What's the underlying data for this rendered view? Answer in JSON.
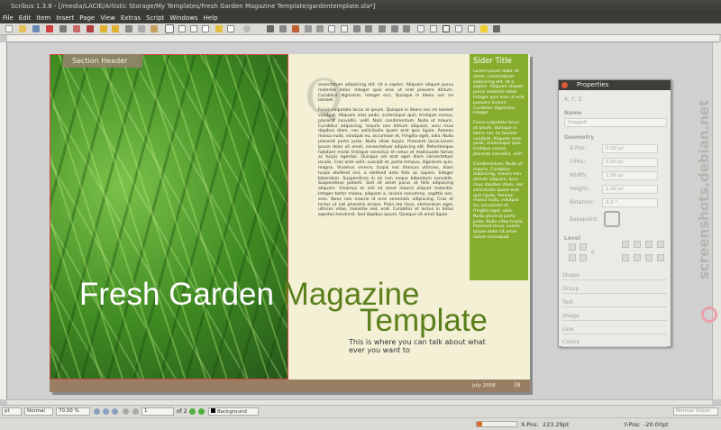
{
  "window": {
    "title": "Scribus 1.3.8 - [/media/LACIE/Artistic Storage/My Templates/Fresh Garden Magazine Template/gardentemplate.sla*]"
  },
  "menu": [
    "File",
    "Edit",
    "Item",
    "Insert",
    "Page",
    "View",
    "Extras",
    "Script",
    "Windows",
    "Help"
  ],
  "page": {
    "section_header": "Section Header",
    "q_letter": "Q",
    "body_paragraphs": [
      "onsectetuer adipiscing elit. Ut a sapien. Aliquam aliquet purus molestie dolor. Integer quis eros ut erat posuere dictum. Curabitur dignissim. Integer orci. Quisque in libero nec mi laoreet.",
      "Fusce vulputate lacus at ipsum. Quisque in libero nec mi laoreet volutpat. Aliquam eros pede, scelerisque quis, tristique cursus, placerat convallis, velit. Nam condimentum. Nulla ut mauris. Curabitur adipiscing, mauris non dictum aliquam, arcu risus dapibus diam, nec sollicitudin quam erat quis ligula. Aenean massa nulla, volutpat eu, accumsan et, fringilla eget, odio. Nulla placerat porta justo. Nulla vitae turpis. Praesent lacus.Lorem ipsum dolor sit amet, consectetuer adipiscing elit. Pellentesque habitant morbi tristique senectus et netus et malesuada fames ac turpis egestas. Quisque vel erat eget diam consectetuer iaculis. Cras ante velit, suscipit et, porta tempus, dignissim quis, magna. Vivamus viverra, turpis nec rhoncus ultricies, diam turpis eleifend nisl, a eleifend ante felis ac sapien. Integer bibendum. Suspendisse in mi non neque bibendum convallis. Suspendisse potenti. Sed sit amet purus at felis adipiscing aliquam. Vivamus et nisl sit amet mauris aliquet molestie. Integer tortor massa, aliquam a, lacinia nonummy, sagittis nec, eros. Nunc non mauris id eros venenatis adipiscing. Cras et lectus ut nisl pharetra ornare. Proin leo risus, elementum eget, ultrices vitae, molestie sed, erat. Curabitur et lectus in tellus egestas hendrerit. Sed dapibus ipsum. Quisque sit amet ligula"
    ],
    "sidebar_title": "Sider Title",
    "sidebar_paragraphs": [
      "Lorem ipsum dolor sit amet, consectetuer adipiscing elit. Ut a sapien. Aliquam aliquet purus molestie dolor. Integer quis eros ut erat posuere dictum. Curabitur dignissim. Integer",
      "Fusce vulputate lacus at ipsum. Quisque in libero nec mi laoreet volutpat. Aliquam eros pede, scelerisque quis, tristique cursus, placerat convallis, velit.",
      "Condimentum. Nulla ut mauris. Curabitur adipiscing, mauris non dictum aliquam, arcu risus dapibus diam, nec sollicitudin quam erat quis ligula. Aenean massa nulla, volutpat eu, accumsan et, fringilla eget, odio. Nulla placerat porta justo. Nulla vitae turpis. Praesent lacus. Lorem ipsum dolor sit amet conse consequat"
    ],
    "title_word_1": "Fresh Garden",
    "title_word_2": "Magazine",
    "title_line_2": "Template",
    "tagline": "This is where you can talk about what ever you want to",
    "footer_date": "July 2008",
    "footer_page": "38"
  },
  "properties": {
    "title": "Properties",
    "xyz_label": "X, Y, Z",
    "name_label": "Name",
    "name_value": "Image4",
    "geometry_label": "Geometry",
    "xpos_label": "X-Pos:",
    "xpos_value": "0.00 pt",
    "ypos_label": "Y-Pos:",
    "ypos_value": "0.00 pt",
    "width_label": "Width:",
    "width_value": "1.00 pt",
    "height_label": "Height:",
    "height_value": "1.00 pt",
    "rotation_label": "Rotation:",
    "rotation_value": "0.0 °",
    "basepoint_label": "Basepoint:",
    "level_label": "Level",
    "level_value": "0",
    "sections": [
      "Shape",
      "Group",
      "Text",
      "Image",
      "Line",
      "Colors"
    ]
  },
  "statusbar": {
    "unit": "pt",
    "mode": "Normal",
    "zoom": "70.00 %",
    "page_num": "1",
    "page_of": "of 2",
    "layer": "Background",
    "view_mode": "Normal Vision"
  },
  "bottombar": {
    "xpos_label": "X-Pos:",
    "xpos_value": "223.29pt",
    "ypos_label": "Y-Pos:",
    "ypos_value": "-20.00pt",
    "progress": 0.14
  },
  "watermark": "screenshots.debian.net",
  "colors": {
    "sidebar": "#87ad2e",
    "title_green": "#5a7f1a",
    "footer": "#9a7e63",
    "page": "#f3f0d6"
  }
}
